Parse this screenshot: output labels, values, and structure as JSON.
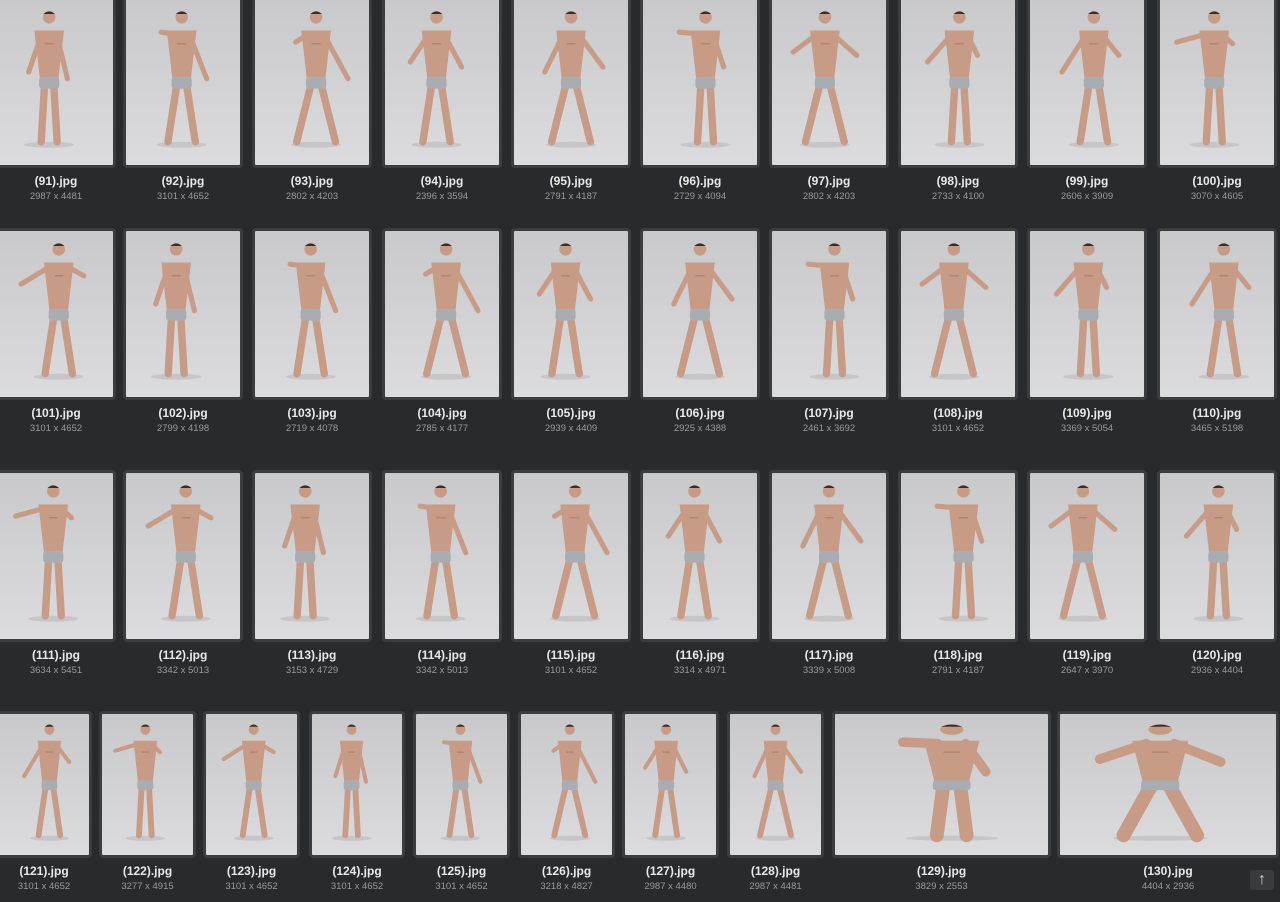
{
  "thumbnails": [
    {
      "name": "(91).jpg",
      "dims": "2987 x 4481"
    },
    {
      "name": "(92).jpg",
      "dims": "3101 x 4652"
    },
    {
      "name": "(93).jpg",
      "dims": "2802 x 4203"
    },
    {
      "name": "(94).jpg",
      "dims": "2396 x 3594"
    },
    {
      "name": "(95).jpg",
      "dims": "2791 x 4187"
    },
    {
      "name": "(96).jpg",
      "dims": "2729 x 4094"
    },
    {
      "name": "(97).jpg",
      "dims": "2802 x 4203"
    },
    {
      "name": "(98).jpg",
      "dims": "2733 x 4100"
    },
    {
      "name": "(99).jpg",
      "dims": "2606 x 3909"
    },
    {
      "name": "(100).jpg",
      "dims": "3070 x 4605"
    },
    {
      "name": "(101).jpg",
      "dims": "3101 x 4652"
    },
    {
      "name": "(102).jpg",
      "dims": "2799 x 4198"
    },
    {
      "name": "(103).jpg",
      "dims": "2719 x 4078"
    },
    {
      "name": "(104).jpg",
      "dims": "2785 x 4177"
    },
    {
      "name": "(105).jpg",
      "dims": "2939 x 4409"
    },
    {
      "name": "(106).jpg",
      "dims": "2925 x 4388"
    },
    {
      "name": "(107).jpg",
      "dims": "2461 x 3692"
    },
    {
      "name": "(108).jpg",
      "dims": "3101 x 4652"
    },
    {
      "name": "(109).jpg",
      "dims": "3369 x 5054"
    },
    {
      "name": "(110).jpg",
      "dims": "3465 x 5198"
    },
    {
      "name": "(111).jpg",
      "dims": "3634 x 5451"
    },
    {
      "name": "(112).jpg",
      "dims": "3342 x 5013"
    },
    {
      "name": "(113).jpg",
      "dims": "3153 x 4729"
    },
    {
      "name": "(114).jpg",
      "dims": "3342 x 5013"
    },
    {
      "name": "(115).jpg",
      "dims": "3101 x 4652"
    },
    {
      "name": "(116).jpg",
      "dims": "3314 x 4971"
    },
    {
      "name": "(117).jpg",
      "dims": "3339 x 5008"
    },
    {
      "name": "(118).jpg",
      "dims": "2791 x 4187"
    },
    {
      "name": "(119).jpg",
      "dims": "2647 x 3970"
    },
    {
      "name": "(120).jpg",
      "dims": "2936 x 4404"
    },
    {
      "name": "(121).jpg",
      "dims": "3101 x 4652"
    },
    {
      "name": "(122).jpg",
      "dims": "3277 x 4915"
    },
    {
      "name": "(123).jpg",
      "dims": "3101 x 4652"
    },
    {
      "name": "(124).jpg",
      "dims": "3101 x 4652"
    },
    {
      "name": "(125).jpg",
      "dims": "3101 x 4652"
    },
    {
      "name": "(126).jpg",
      "dims": "3218 x 4827"
    },
    {
      "name": "(127).jpg",
      "dims": "2987 x 4480"
    },
    {
      "name": "(128).jpg",
      "dims": "2987 x 4481"
    },
    {
      "name": "(129).jpg",
      "dims": "3829 x 2553"
    },
    {
      "name": "(130).jpg",
      "dims": "4404 x 2936"
    }
  ],
  "scroll_button": {
    "icon": "arrow-up-icon",
    "glyph": "↑"
  }
}
